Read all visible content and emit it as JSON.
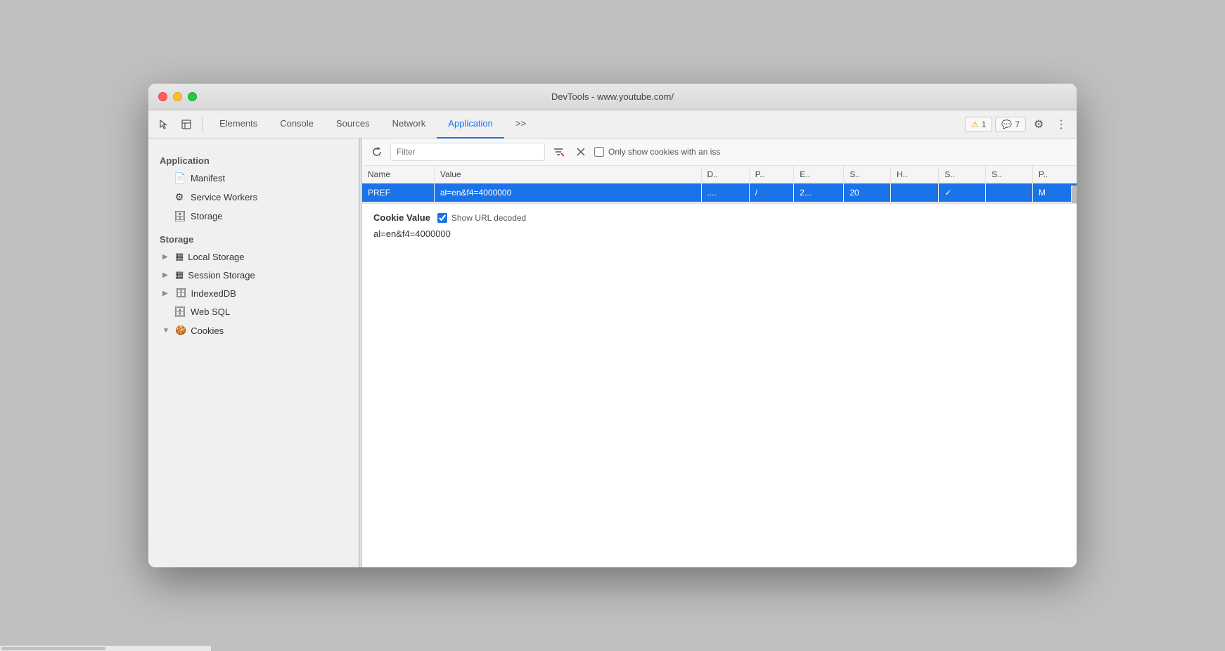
{
  "window": {
    "title": "DevTools - www.youtube.com/"
  },
  "toolbar": {
    "tabs": [
      {
        "id": "elements",
        "label": "Elements",
        "active": false
      },
      {
        "id": "console",
        "label": "Console",
        "active": false
      },
      {
        "id": "sources",
        "label": "Sources",
        "active": false
      },
      {
        "id": "network",
        "label": "Network",
        "active": false
      },
      {
        "id": "application",
        "label": "Application",
        "active": true
      }
    ],
    "more_tabs_label": ">>",
    "warn_badge_label": "1",
    "info_badge_label": "7",
    "gear_icon": "⚙",
    "more_icon": "⋮"
  },
  "sidebar": {
    "application_section": "Application",
    "items_app": [
      {
        "id": "manifest",
        "label": "Manifest",
        "icon": "📄"
      },
      {
        "id": "service-workers",
        "label": "Service Workers",
        "icon": "⚙"
      },
      {
        "id": "storage-app",
        "label": "Storage",
        "icon": "🗄"
      }
    ],
    "storage_section": "Storage",
    "items_storage": [
      {
        "id": "local-storage",
        "label": "Local Storage",
        "expandable": true
      },
      {
        "id": "session-storage",
        "label": "Session Storage",
        "expandable": true
      },
      {
        "id": "indexeddb",
        "label": "IndexedDB",
        "expandable": true
      },
      {
        "id": "web-sql",
        "label": "Web SQL"
      },
      {
        "id": "cookies",
        "label": "Cookies",
        "expanded": true
      }
    ]
  },
  "cookie_panel": {
    "filter_placeholder": "Filter",
    "only_show_label": "Only show cookies with an iss",
    "table_headers": [
      "Name",
      "Value",
      "D..",
      "P..",
      "E..",
      "S..",
      "H..",
      "S..",
      "S..",
      "P.."
    ],
    "table_rows": [
      {
        "name": "PREF",
        "value": "al=en&f4=4000000",
        "domain": "....",
        "path": "/",
        "expires": "2...",
        "size": "20",
        "httponly": "",
        "secure": "✓",
        "samesite": "",
        "priority": "M"
      }
    ],
    "selected_row_index": 0,
    "cookie_value_label": "Cookie Value",
    "show_url_decoded_label": "Show URL decoded",
    "cookie_value_text": "al=en&f4=4000000"
  }
}
